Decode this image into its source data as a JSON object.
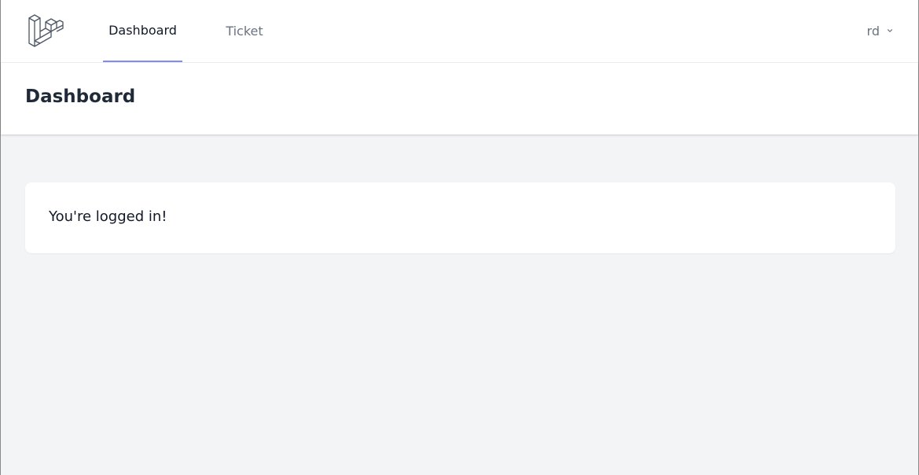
{
  "nav": {
    "logo_icon": "laravel-logo-icon",
    "links": [
      {
        "label": "Dashboard",
        "active": true
      },
      {
        "label": "Ticket",
        "active": false
      }
    ],
    "user": {
      "name": "rd",
      "icon": "chevron-down-icon"
    }
  },
  "header": {
    "title": "Dashboard"
  },
  "main": {
    "message": "You're logged in!"
  },
  "colors": {
    "background": "#f3f4f6",
    "active_indicator": "#818cf8",
    "text_primary": "#111827",
    "text_muted": "#6b7280"
  }
}
